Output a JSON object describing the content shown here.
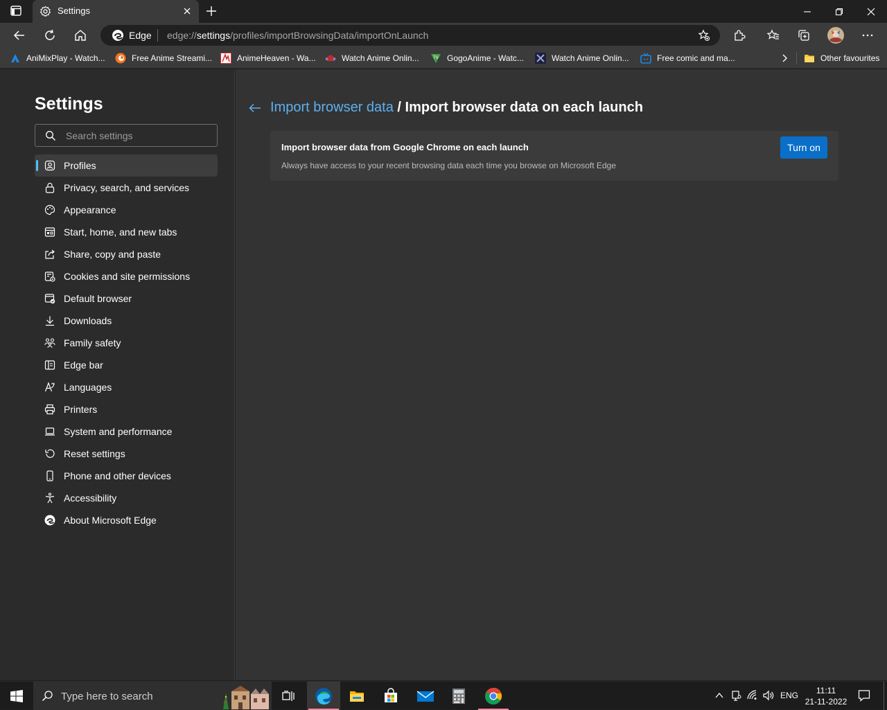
{
  "window": {
    "tab_title": "Settings"
  },
  "toolbar": {
    "browser_label": "Edge",
    "url_prefix": "edge://",
    "url_host": "settings",
    "url_path": "/profiles/importBrowsingData/importOnLaunch"
  },
  "favorites": {
    "items": [
      {
        "label": "AniMixPlay - Watch...",
        "icon": "animixplay-icon",
        "color": "#1e88e5"
      },
      {
        "label": "Free Anime Streami...",
        "icon": "crunchyroll-icon",
        "color": "#f47521"
      },
      {
        "label": "AnimeHeaven - Wa...",
        "icon": "animeheaven-icon",
        "color": "#d32f2f"
      },
      {
        "label": "Watch Anime Onlin...",
        "icon": "planet-icon",
        "color": "#c62828"
      },
      {
        "label": "GogoAnime - Watc...",
        "icon": "gogoanime-icon",
        "color": "#43a047"
      },
      {
        "label": "Watch Anime Onlin...",
        "icon": "x-logo-icon",
        "color": "#5c6bc0"
      },
      {
        "label": "Free comic and ma...",
        "icon": "tv-icon",
        "color": "#1e88e5"
      }
    ],
    "other_label": "Other favourites"
  },
  "sidebar": {
    "title": "Settings",
    "search_placeholder": "Search settings",
    "items": [
      {
        "label": "Profiles",
        "icon": "profile-icon"
      },
      {
        "label": "Privacy, search, and services",
        "icon": "lock-icon"
      },
      {
        "label": "Appearance",
        "icon": "palette-icon"
      },
      {
        "label": "Start, home, and new tabs",
        "icon": "start-page-icon"
      },
      {
        "label": "Share, copy and paste",
        "icon": "share-icon"
      },
      {
        "label": "Cookies and site permissions",
        "icon": "cookies-icon"
      },
      {
        "label": "Default browser",
        "icon": "default-browser-icon"
      },
      {
        "label": "Downloads",
        "icon": "download-icon"
      },
      {
        "label": "Family safety",
        "icon": "family-icon"
      },
      {
        "label": "Edge bar",
        "icon": "edge-bar-icon"
      },
      {
        "label": "Languages",
        "icon": "languages-icon"
      },
      {
        "label": "Printers",
        "icon": "printer-icon"
      },
      {
        "label": "System and performance",
        "icon": "laptop-icon"
      },
      {
        "label": "Reset settings",
        "icon": "reset-icon"
      },
      {
        "label": "Phone and other devices",
        "icon": "phone-icon"
      },
      {
        "label": "Accessibility",
        "icon": "accessibility-icon"
      },
      {
        "label": "About Microsoft Edge",
        "icon": "edge-logo-icon"
      }
    ]
  },
  "main": {
    "breadcrumb_parent": "Import browser data",
    "breadcrumb_separator": "/",
    "breadcrumb_current": "Import browser data on each launch",
    "card_title": "Import browser data from Google Chrome on each launch",
    "card_description": "Always have access to your recent browsing data each time you browse on Microsoft Edge",
    "button_label": "Turn on"
  },
  "taskbar": {
    "search_placeholder": "Type here to search",
    "language": "ENG",
    "time": "11:11",
    "date": "21-11-2022"
  },
  "colors": {
    "accent": "#0a6fc9",
    "link": "#5cb0f0",
    "active_indicator": "#4cc2ff"
  }
}
